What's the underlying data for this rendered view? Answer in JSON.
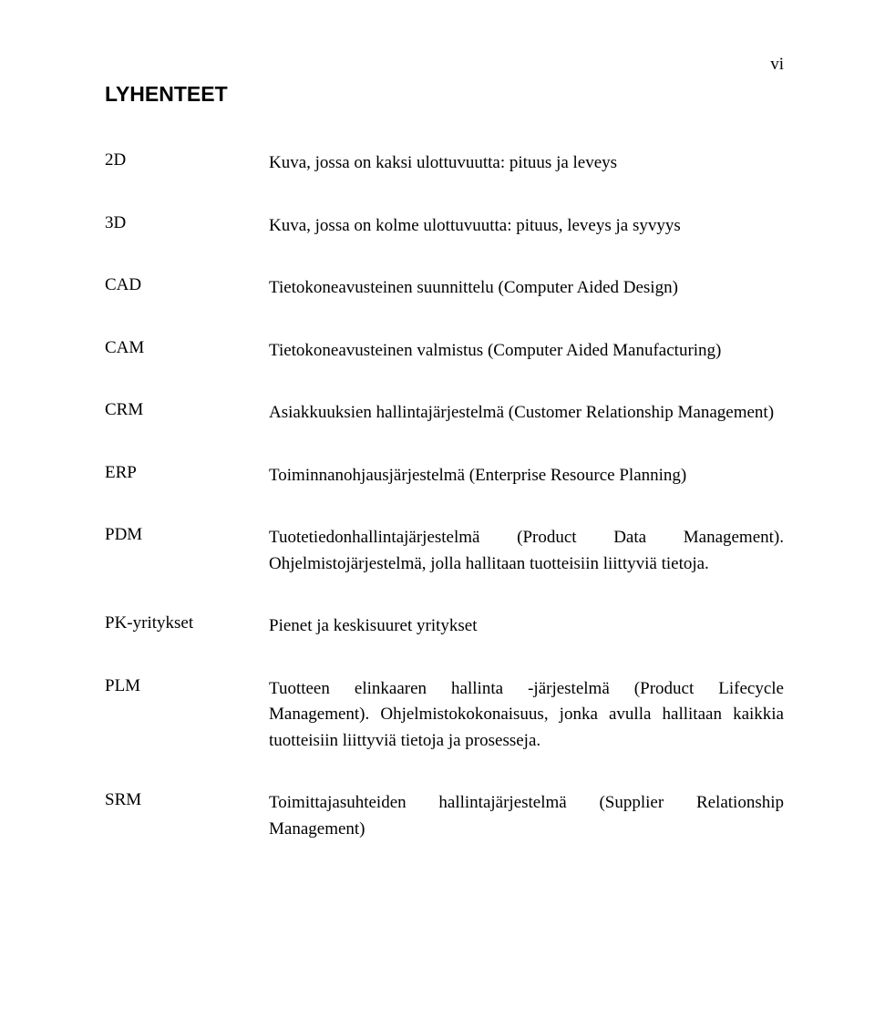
{
  "pageNumber": "vi",
  "heading": "LYHENTEET",
  "entries": [
    {
      "term": "2D",
      "def": "Kuva, jossa on kaksi ulottuvuutta: pituus ja leveys"
    },
    {
      "term": "3D",
      "def": "Kuva, jossa on kolme ulottuvuutta: pituus, leveys ja syvyys"
    },
    {
      "term": "CAD",
      "def": "Tietokoneavusteinen suunnittelu (Computer Aided Design)"
    },
    {
      "term": "CAM",
      "def": "Tietokoneavusteinen valmistus (Computer Aided Manufacturing)"
    },
    {
      "term": "CRM",
      "def": "Asiakkuuksien hallintajärjestelmä (Customer Relationship Management)"
    },
    {
      "term": "ERP",
      "def": "Toiminnanohjausjärjestelmä (Enterprise Resource Planning)"
    },
    {
      "term": "PDM",
      "def": "Tuotetiedonhallintajärjestelmä (Product Data Management). Ohjelmistojärjestelmä, jolla hallitaan tuotteisiin liittyviä tietoja."
    },
    {
      "term": "PK-yritykset",
      "def": "Pienet ja keskisuuret yritykset"
    },
    {
      "term": "PLM",
      "def": "Tuotteen elinkaaren hallinta -järjestelmä (Product Lifecycle Management). Ohjelmistokokonaisuus, jonka avulla hallitaan kaikkia tuotteisiin liittyviä tietoja ja prosesseja."
    },
    {
      "term": "SRM",
      "def": "Toimittajasuhteiden hallintajärjestelmä (Supplier Relationship Management)"
    }
  ]
}
